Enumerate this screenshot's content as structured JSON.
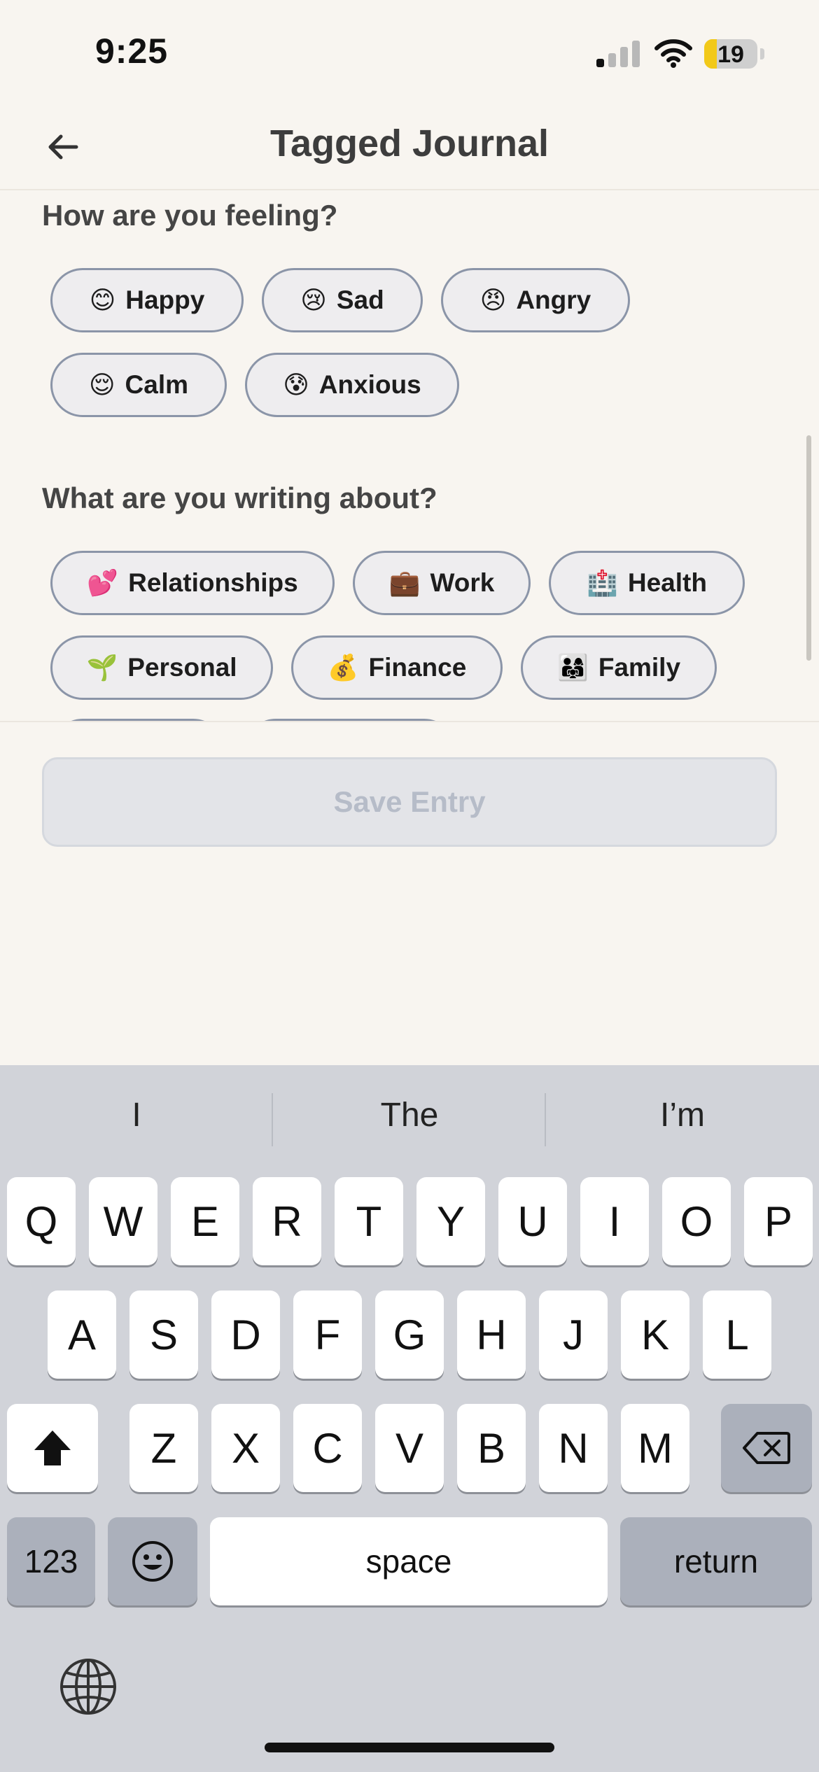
{
  "status_bar": {
    "time": "9:25",
    "battery": "19"
  },
  "header": {
    "title": "Tagged Journal"
  },
  "feelings": {
    "title": "How are you feeling?",
    "chips": [
      {
        "emoji": "😊",
        "label": "Happy"
      },
      {
        "emoji": "😢",
        "label": "Sad"
      },
      {
        "emoji": "😠",
        "label": "Angry"
      },
      {
        "emoji": "😌",
        "label": "Calm"
      },
      {
        "emoji": "😰",
        "label": "Anxious"
      }
    ]
  },
  "topics": {
    "title": "What are you writing about?",
    "chips": [
      {
        "emoji": "💕",
        "label": "Relationships"
      },
      {
        "emoji": "💼",
        "label": "Work"
      },
      {
        "emoji": "🏥",
        "label": "Health"
      },
      {
        "emoji": "🌱",
        "label": "Personal"
      },
      {
        "emoji": "💰",
        "label": "Finance"
      },
      {
        "emoji": "👨‍👩‍👧",
        "label": "Family"
      }
    ]
  },
  "save_button": {
    "label": "Save Entry"
  },
  "keyboard": {
    "suggestions": [
      "I",
      "The",
      "I’m"
    ],
    "row1": [
      "Q",
      "W",
      "E",
      "R",
      "T",
      "Y",
      "U",
      "I",
      "O",
      "P"
    ],
    "row2": [
      "A",
      "S",
      "D",
      "F",
      "G",
      "H",
      "J",
      "K",
      "L"
    ],
    "row3": [
      "Z",
      "X",
      "C",
      "V",
      "B",
      "N",
      "M"
    ],
    "numbers_key": "123",
    "space_key": "space",
    "return_key": "return",
    "icons": [
      "shift-icon",
      "backspace-icon",
      "emoji-icon",
      "globe-icon"
    ]
  },
  "colors": {
    "background": "#f8f5f0",
    "chip_border": "#8b95a8",
    "chip_fill": "#eeedef",
    "save_disabled_text": "#b6bcc8",
    "keyboard_bg": "#d1d3d9"
  }
}
